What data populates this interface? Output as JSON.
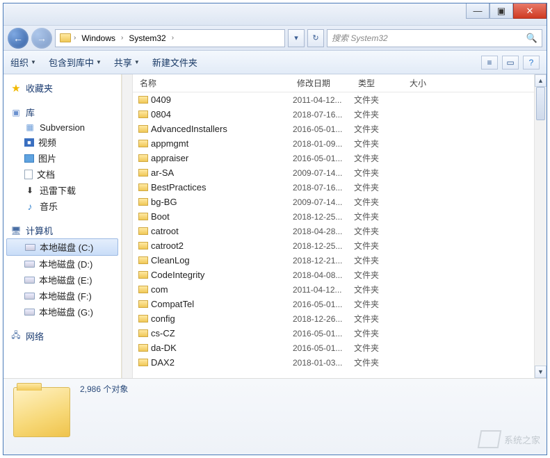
{
  "window_buttons": {
    "min": "—",
    "max": "▣",
    "close": "✕"
  },
  "nav": {
    "back": "←",
    "fwd": "→"
  },
  "breadcrumb": {
    "parts": [
      "Windows",
      "System32"
    ],
    "sep": "›",
    "dd": "▾",
    "refresh": "↻"
  },
  "search": {
    "placeholder": "搜索 System32",
    "icon": "🔍"
  },
  "toolbar": {
    "organize": "组织",
    "include": "包含到库中",
    "share": "共享",
    "newfolder": "新建文件夹",
    "view_icon": "≡",
    "pane_icon": "▭",
    "help_icon": "?"
  },
  "sidebar": {
    "favorites": "收藏夹",
    "libraries": "库",
    "lib_items": [
      {
        "label": "Subversion",
        "ic": "sub"
      },
      {
        "label": "视频",
        "ic": "vid"
      },
      {
        "label": "图片",
        "ic": "img"
      },
      {
        "label": "文档",
        "ic": "doc"
      },
      {
        "label": "迅雷下载",
        "ic": "dl"
      },
      {
        "label": "音乐",
        "ic": "music"
      }
    ],
    "computer": "计算机",
    "drives": [
      {
        "label": "本地磁盘 (C:)",
        "sel": true
      },
      {
        "label": "本地磁盘 (D:)",
        "sel": false
      },
      {
        "label": "本地磁盘 (E:)",
        "sel": false
      },
      {
        "label": "本地磁盘 (F:)",
        "sel": false
      },
      {
        "label": "本地磁盘 (G:)",
        "sel": false
      }
    ],
    "network": "网络"
  },
  "columns": {
    "name": "名称",
    "date": "修改日期",
    "type": "类型",
    "size": "大小"
  },
  "files": [
    {
      "name": "0409",
      "date": "2011-04-12...",
      "type": "文件夹"
    },
    {
      "name": "0804",
      "date": "2018-07-16...",
      "type": "文件夹"
    },
    {
      "name": "AdvancedInstallers",
      "date": "2016-05-01...",
      "type": "文件夹"
    },
    {
      "name": "appmgmt",
      "date": "2018-01-09...",
      "type": "文件夹"
    },
    {
      "name": "appraiser",
      "date": "2016-05-01...",
      "type": "文件夹"
    },
    {
      "name": "ar-SA",
      "date": "2009-07-14...",
      "type": "文件夹"
    },
    {
      "name": "BestPractices",
      "date": "2018-07-16...",
      "type": "文件夹"
    },
    {
      "name": "bg-BG",
      "date": "2009-07-14...",
      "type": "文件夹"
    },
    {
      "name": "Boot",
      "date": "2018-12-25...",
      "type": "文件夹"
    },
    {
      "name": "catroot",
      "date": "2018-04-28...",
      "type": "文件夹"
    },
    {
      "name": "catroot2",
      "date": "2018-12-25...",
      "type": "文件夹"
    },
    {
      "name": "CleanLog",
      "date": "2018-12-21...",
      "type": "文件夹"
    },
    {
      "name": "CodeIntegrity",
      "date": "2018-04-08...",
      "type": "文件夹"
    },
    {
      "name": "com",
      "date": "2011-04-12...",
      "type": "文件夹"
    },
    {
      "name": "CompatTel",
      "date": "2016-05-01...",
      "type": "文件夹"
    },
    {
      "name": "config",
      "date": "2018-12-26...",
      "type": "文件夹"
    },
    {
      "name": "cs-CZ",
      "date": "2016-05-01...",
      "type": "文件夹"
    },
    {
      "name": "da-DK",
      "date": "2016-05-01...",
      "type": "文件夹"
    },
    {
      "name": "DAX2",
      "date": "2018-01-03...",
      "type": "文件夹"
    }
  ],
  "status": {
    "count": "2,986 个对象"
  },
  "watermark": "系统之家"
}
